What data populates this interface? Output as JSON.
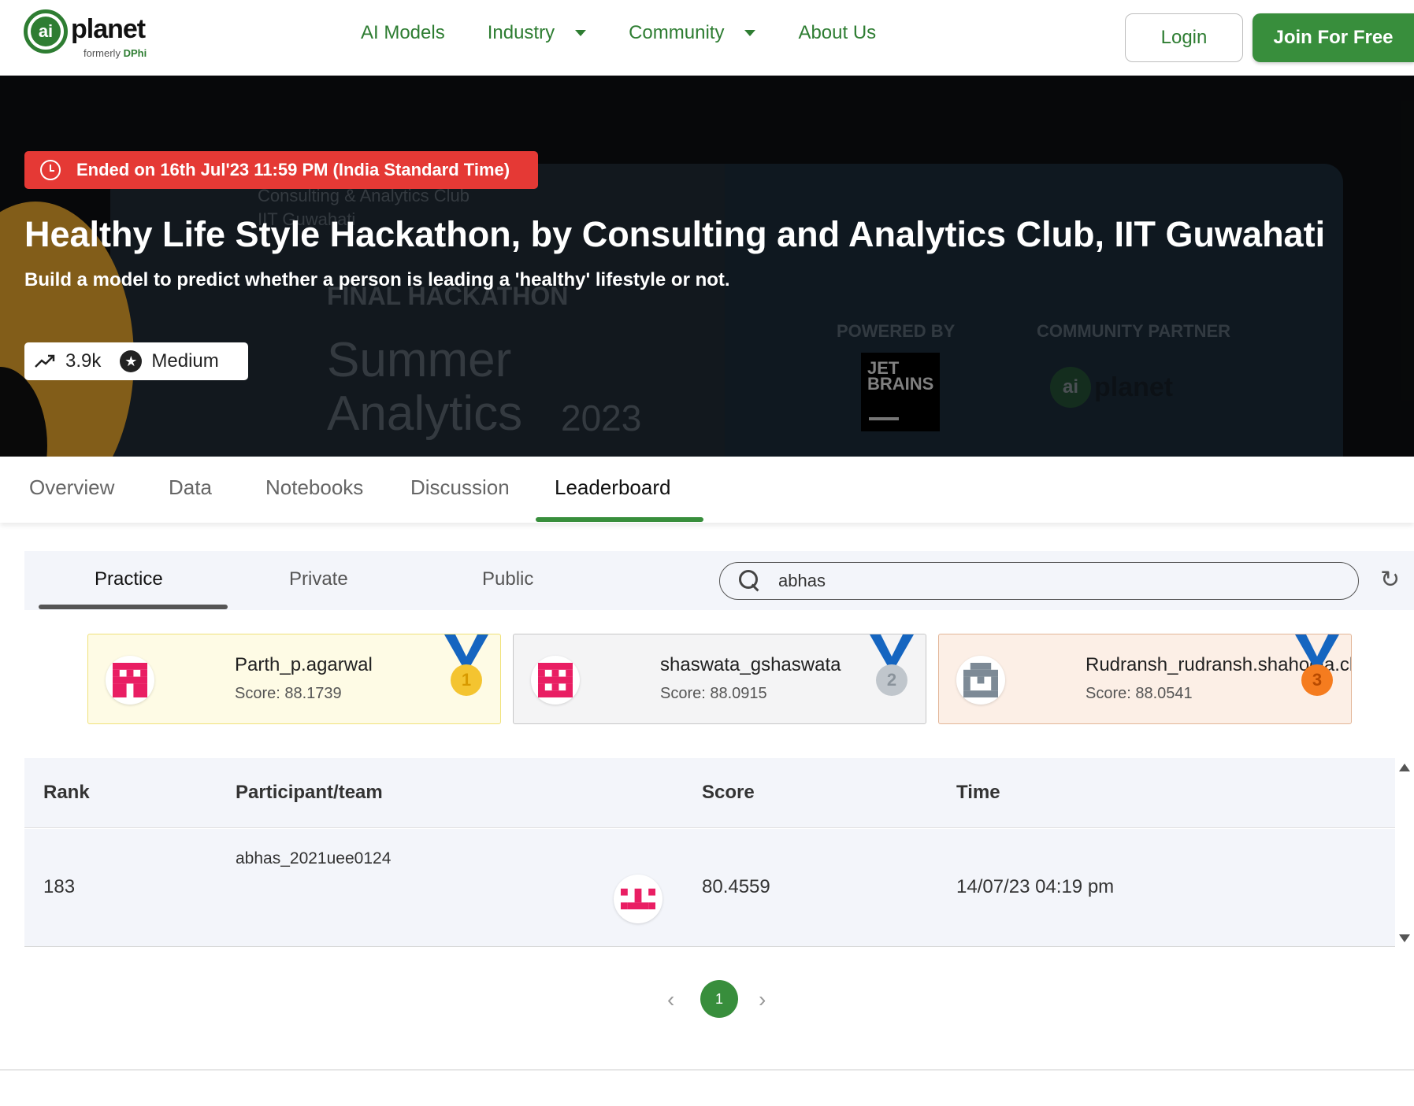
{
  "header": {
    "logo_mark": "ai",
    "logo_word": "planet",
    "logo_formerly": "formerly",
    "logo_formerly_brand": "DPhi",
    "nav": [
      {
        "label": "AI Models",
        "dropdown": false
      },
      {
        "label": "Industry",
        "dropdown": true
      },
      {
        "label": "Community",
        "dropdown": true
      },
      {
        "label": "About Us",
        "dropdown": false
      }
    ],
    "login_label": "Login",
    "join_label": "Join For Free",
    "accent_color": "#2e7d32"
  },
  "hero": {
    "ended_text": "Ended on 16th Jul'23 11:59 PM (India Standard Time)",
    "title": "Healthy Life Style Hackathon, by Consulting and Analytics Club, IIT Guwahati",
    "subtitle": "Build a model to predict whether a person is leading a 'healthy' lifestyle or not.",
    "views": "3.9k",
    "difficulty": "Medium",
    "banner": {
      "club_line1": "Consulting & Analytics Club",
      "club_line2": "IIT Guwahati",
      "final_hackathon": "FINAL HACKATHON",
      "summer": "Summer",
      "analytics": "Analytics",
      "year": "2023",
      "powered_by": "POWERED BY",
      "community_partner": "COMMUNITY PARTNER",
      "jetbrains_line1": "JET",
      "jetbrains_line2": "BRAINS",
      "partner_mark": "ai",
      "partner_word": "planet"
    },
    "badge_color": "#e53935"
  },
  "tabs": [
    {
      "label": "Overview",
      "active": false
    },
    {
      "label": "Data",
      "active": false
    },
    {
      "label": "Notebooks",
      "active": false
    },
    {
      "label": "Discussion",
      "active": false
    },
    {
      "label": "Leaderboard",
      "active": true
    }
  ],
  "leaderboard": {
    "subtabs": [
      {
        "label": "Practice",
        "active": true
      },
      {
        "label": "Private",
        "active": false
      },
      {
        "label": "Public",
        "active": false
      }
    ],
    "search_value": "abhas",
    "top3": [
      {
        "rank": "1",
        "name": "Parth_p.agarwal",
        "score": "Score: 88.1739",
        "avatar_color": "#e91e63",
        "medal_color": "#f4c430"
      },
      {
        "rank": "2",
        "name": "shaswata_gshaswata",
        "score": "Score: 88.0915",
        "avatar_color": "#e91e63",
        "medal_color": "#c0c6cc"
      },
      {
        "rank": "3",
        "name": "Rudransh_rudransh.shahodia.che",
        "score": "Score: 88.0541",
        "avatar_color": "#7d8a96",
        "medal_color": "#f57c1f"
      }
    ],
    "columns": [
      "Rank",
      "Participant/team",
      "Score",
      "Time"
    ],
    "rows": [
      {
        "rank": "183",
        "participant": "abhas_2021uee0124",
        "score": "80.4559",
        "time": "14/07/23 04:19 pm",
        "avatar_color": "#e91e63"
      }
    ],
    "pagination": {
      "current": "1",
      "prev": "‹",
      "next": "›"
    }
  }
}
